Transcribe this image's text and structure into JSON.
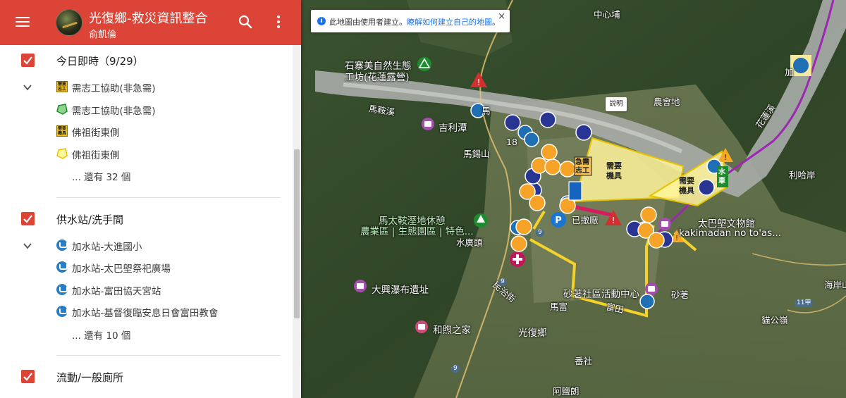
{
  "header": {
    "title": "光復鄉-救災資訊整合",
    "author": "俞凱倫"
  },
  "layers": [
    {
      "title": "今日即時（9/29）",
      "features": [
        {
          "label": "需志工協助(非急需)",
          "icon": "volunteer-needed-icon",
          "icon_text": "需要志工"
        },
        {
          "label": "需志工協助(非急需)",
          "icon": "green-area-icon"
        },
        {
          "label": "佛祖街東側",
          "icon": "machinery-needed-icon",
          "icon_text": "需要機具"
        },
        {
          "label": "佛祖街東側",
          "icon": "yellow-area-icon"
        }
      ],
      "more": "... 還有 32 個"
    },
    {
      "title": "供水站/洗手間",
      "features": [
        {
          "label": "加水站-大進國小",
          "icon": "water-station-icon"
        },
        {
          "label": "加水站-太巴塱祭祀廣場",
          "icon": "water-station-icon"
        },
        {
          "label": "加水站-富田協天宮站",
          "icon": "water-station-icon"
        },
        {
          "label": "加水站-基督復臨安息日會富田教會",
          "icon": "water-station-icon"
        }
      ],
      "more": "... 還有 10 個"
    },
    {
      "title": "流動/一般廁所",
      "features": [],
      "more": ""
    }
  ],
  "map": {
    "info_banner": {
      "text": "此地圖由使用者建立。",
      "link": "瞭解如何建立自己的地圖",
      "suffix": "。",
      "close": "×"
    },
    "explain_box": "說明",
    "polygon_labels": {
      "volunteer": "需要\n機具",
      "machinery": "需要\n機具",
      "small_volunteer": "急需\n志工",
      "water_truck": "水\n車"
    },
    "labels": [
      {
        "text": "中心埔",
        "kind": "normal"
      },
      {
        "text": "石寨美自然生態",
        "kind": "big"
      },
      {
        "text": "工坊(花蓮露營)",
        "kind": "big"
      },
      {
        "text": "馬鞍溪",
        "kind": "normal"
      },
      {
        "text": "吉利潭",
        "kind": "big"
      },
      {
        "text": "馬錫山",
        "kind": "normal"
      },
      {
        "text": "18",
        "kind": "normal"
      },
      {
        "text": "馬",
        "kind": "normal"
      },
      {
        "text": "農會地",
        "kind": "normal"
      },
      {
        "text": "花蓮溪",
        "kind": "normal"
      },
      {
        "text": "利哈岸",
        "kind": "normal"
      },
      {
        "text": "馬太鞍溼地休憩",
        "kind": "green"
      },
      {
        "text": "農業區 | 生態園區 | 特色...",
        "kind": "green"
      },
      {
        "text": "水廣頭",
        "kind": "normal"
      },
      {
        "text": "太巴塱文物館",
        "kind": "big"
      },
      {
        "text": "kakimadan no to'as...",
        "kind": "big"
      },
      {
        "text": "大興瀑布遺址",
        "kind": "big"
      },
      {
        "text": "民治街",
        "kind": "normal"
      },
      {
        "text": "砂荖社區活動中心",
        "kind": "big"
      },
      {
        "text": "砂荖",
        "kind": "normal"
      },
      {
        "text": "馬富",
        "kind": "normal"
      },
      {
        "text": "富田",
        "kind": "normal"
      },
      {
        "text": "和煦之家",
        "kind": "big"
      },
      {
        "text": "光復鄉",
        "kind": "big"
      },
      {
        "text": "番社",
        "kind": "normal"
      },
      {
        "text": "阿鹽朗",
        "kind": "normal"
      },
      {
        "text": "貓公嶺",
        "kind": "normal"
      },
      {
        "text": "海岸山",
        "kind": "normal"
      },
      {
        "text": "已撤廠",
        "kind": "normal"
      },
      {
        "text": "加",
        "kind": "normal"
      }
    ],
    "road_badges": [
      "9",
      "9",
      "11甲",
      "9"
    ]
  }
}
